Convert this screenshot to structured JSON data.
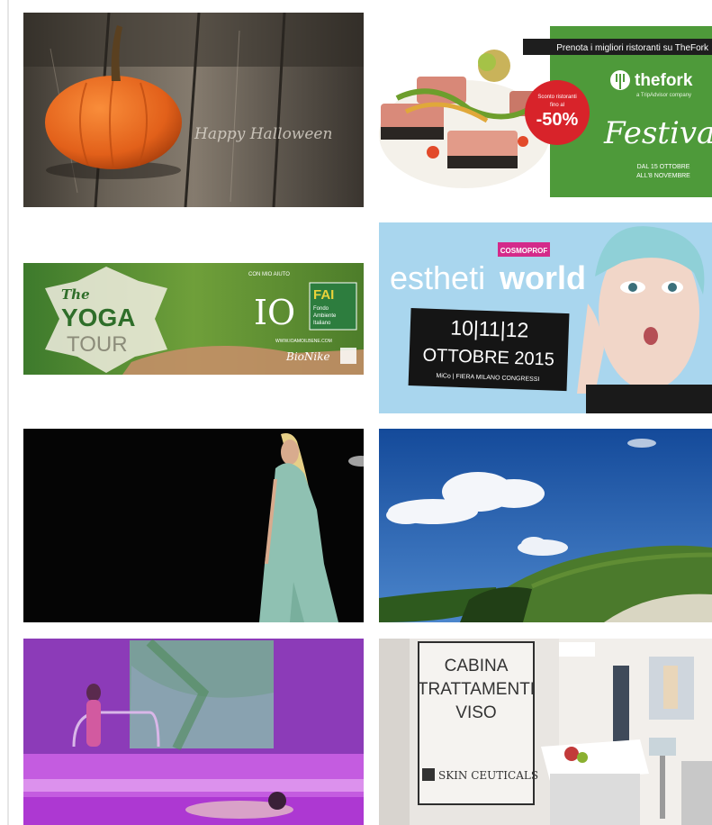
{
  "gallery": {
    "halloween": {
      "text": "Happy Halloween"
    },
    "thefork": {
      "banner": "Prenota i migliori ristoranti su TheFork",
      "brand": "thefork",
      "brand_sub": "a TripAdvisor company",
      "badge_line1": "Sconto ristoranti",
      "badge_line2": "fino al",
      "badge_value": "-50%",
      "festival": "Festival",
      "dates_line1": "DAL 15 OTTOBRE",
      "dates_line2": "ALL'8 NOVEMBRE"
    },
    "yoga": {
      "the": "The",
      "yoga": "YOGA",
      "tour": "TOUR",
      "partner_line": "CON MIO AIUTO",
      "io": "IO",
      "fai": "FAI",
      "fai_line1": "Fondo",
      "fai_line2": "Ambiente",
      "fai_line3": "Italiano",
      "footer_url": "WWW.IOAMOILBENE.COM",
      "signature": "BioNike"
    },
    "esthetiworld": {
      "logo": "COSMOPROF",
      "title_a": "estheti",
      "title_b": "world",
      "dates": "10|11|12",
      "month": "OTTOBRE 2015",
      "venue": "MiCo | FIERA MILANO CONGRESSI"
    },
    "cabina": {
      "line1": "CABINA",
      "line2": "TRATTAMENTI",
      "line3": "VISO",
      "brand": "SKIN CEUTICALS"
    }
  }
}
